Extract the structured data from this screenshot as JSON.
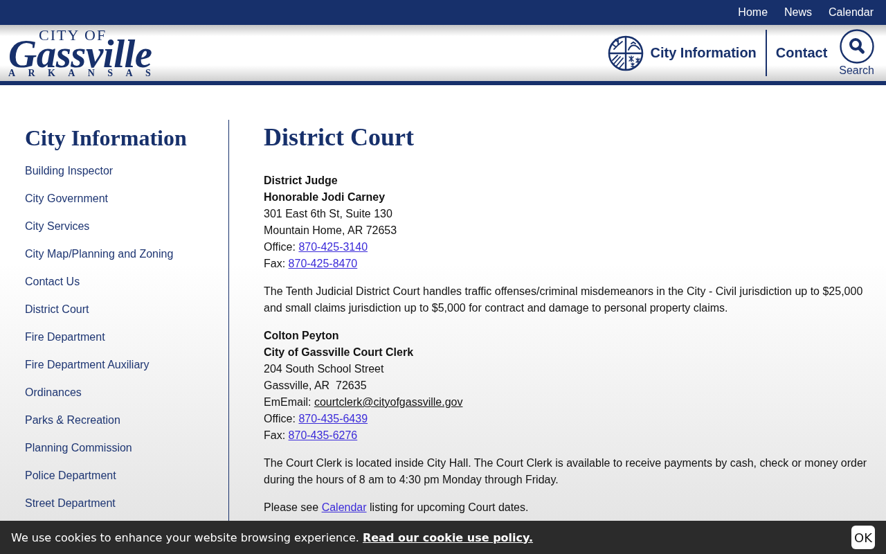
{
  "top_nav": [
    "Home",
    "News",
    "Calendar"
  ],
  "header": {
    "logo": {
      "line_1": "CITY OF",
      "line_2": "Gassville",
      "line_3": "ARKANSAS"
    },
    "nav": [
      {
        "kind": "emblem",
        "label": "City Information"
      },
      {
        "kind": "plain",
        "label": "Contact"
      }
    ],
    "search": {
      "label": "Search"
    }
  },
  "sidebar": {
    "title": "City Information",
    "items": [
      "Building Inspector",
      "City Government",
      "City Services",
      "City Map/Planning and Zoning",
      "Contact Us",
      "District Court",
      "Fire Department",
      "Fire Department Auxiliary",
      "Ordinances",
      "Parks & Recreation",
      "Planning Commission",
      "Police Department",
      "Street Department"
    ]
  },
  "content": {
    "title": "District Court",
    "blocks": [
      {
        "kind": "address",
        "lines": [
          {
            "kind": "bold",
            "text": "District Judge"
          },
          {
            "kind": "bold",
            "text": "Honorable Jodi Carney"
          },
          {
            "kind": "plain",
            "text": "301 East 6th St, Suite 130"
          },
          {
            "kind": "plain",
            "text": "Mountain Home, AR 72653"
          },
          {
            "kind": "phone",
            "label": "Office:",
            "link": "870-425-3140"
          },
          {
            "kind": "phone",
            "label": "Fax:",
            "link": "870-425-8470"
          }
        ]
      },
      {
        "kind": "paragraph",
        "parts": [
          {
            "kind": "text",
            "text": "The Tenth Judicial District Court handles traffic offenses/criminal misdemeanors in the City - Civil jurisdiction up to $25,000 and small claims jurisdiction up to $5,000 for contract and damage to personal property claims."
          }
        ]
      },
      {
        "kind": "address",
        "lines": [
          {
            "kind": "bold",
            "text": "Colton Peyton"
          },
          {
            "kind": "bold",
            "text": "City of Gassville Court Clerk"
          },
          {
            "kind": "plain",
            "text": "204 South School Street"
          },
          {
            "kind": "plain",
            "text": "Gassville, AR  72635"
          },
          {
            "kind": "email",
            "label": "EmEmail:",
            "link": "courtclerk@cityofgassville.gov"
          },
          {
            "kind": "phone",
            "label": "Office:",
            "link": "870-435-6439"
          },
          {
            "kind": "phone",
            "label": "Fax:",
            "link": "870-435-6276"
          }
        ]
      },
      {
        "kind": "paragraph",
        "parts": [
          {
            "kind": "text",
            "text": "The Court Clerk is located inside City Hall. The Court Clerk is available to receive payments by cash, check or money order during the hours of 8 am to 4:30 pm Monday through Friday."
          }
        ]
      },
      {
        "kind": "paragraph",
        "parts": [
          {
            "kind": "text",
            "text": "Please see"
          },
          {
            "kind": "link",
            "text": "Calendar"
          },
          {
            "kind": "text",
            "text": "listing for upcoming Court dates."
          }
        ]
      }
    ]
  },
  "cookie_bar": {
    "message": "We use cookies to enhance your website browsing experience.",
    "link": "Read our cookie use policy.",
    "button": "OK"
  }
}
